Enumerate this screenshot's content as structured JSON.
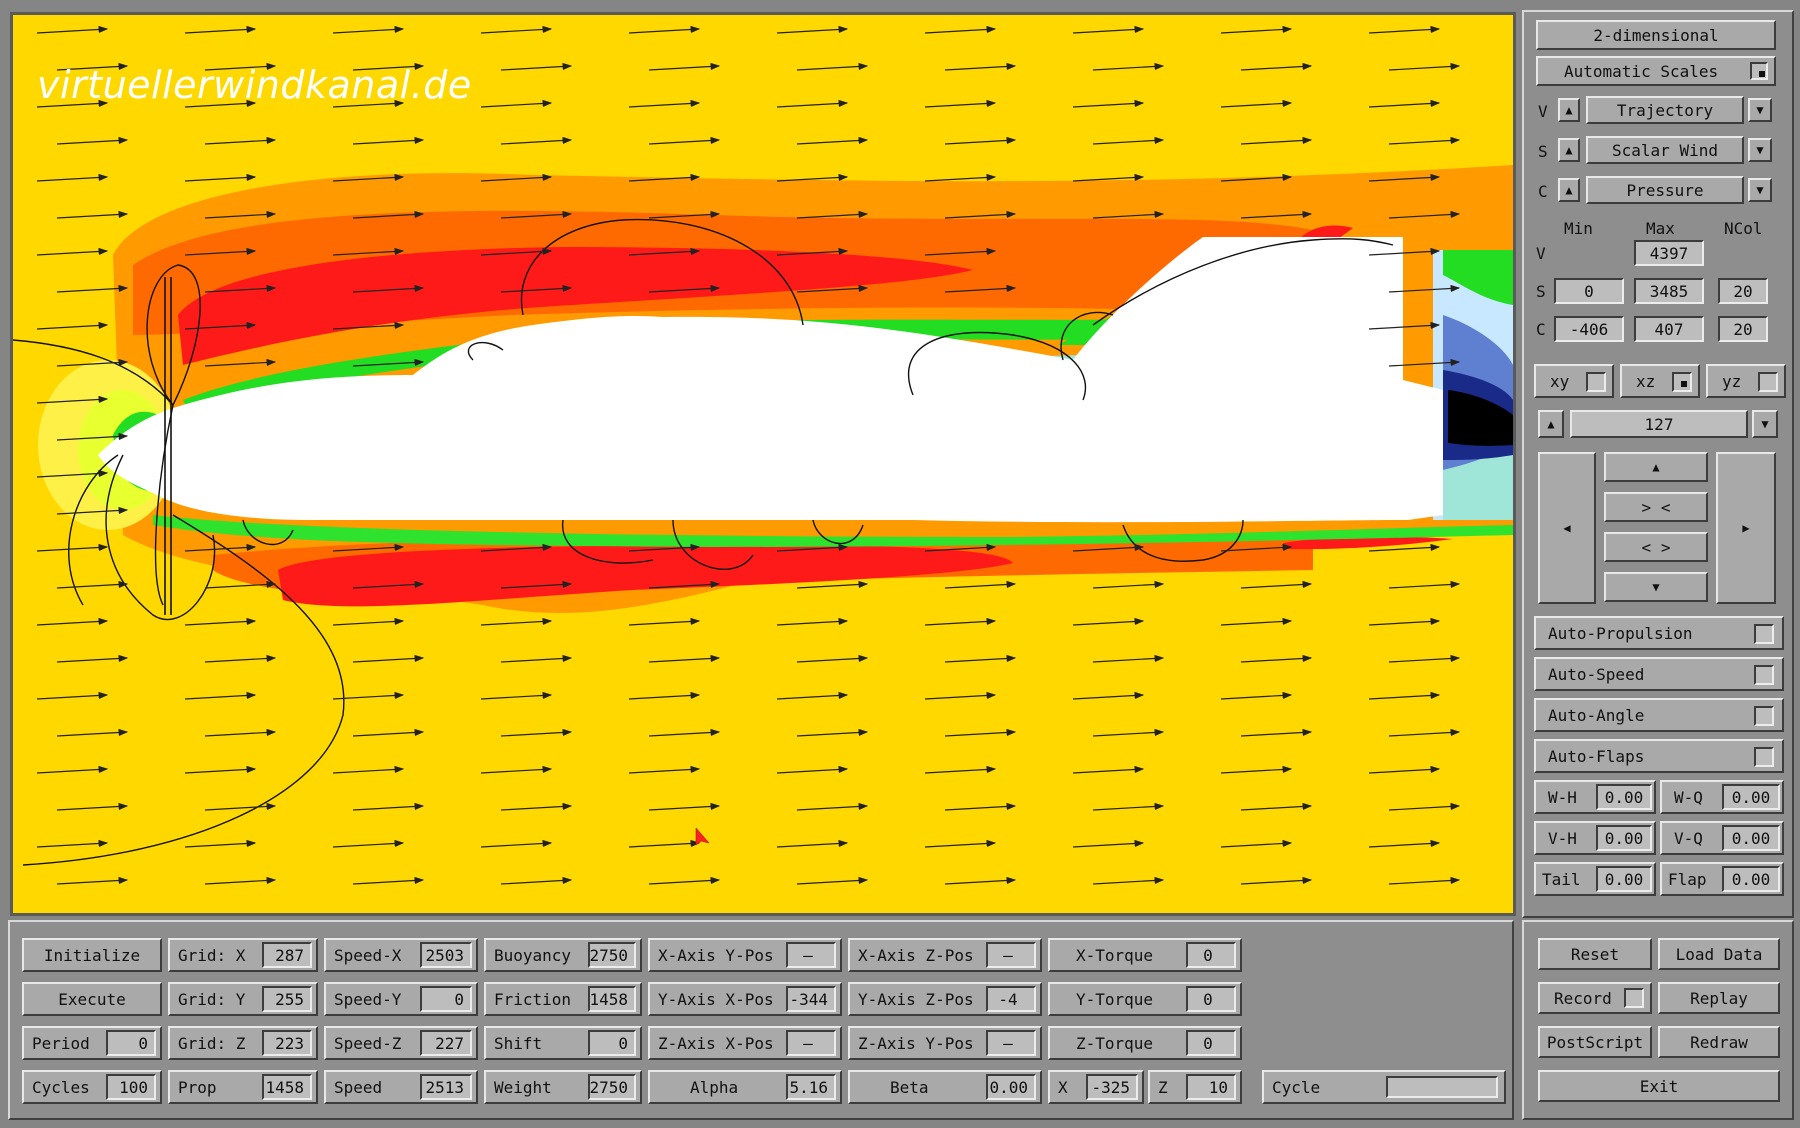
{
  "watermark": "virtuellerwindkanal.de",
  "colors": {
    "ambient": "#ffd800",
    "orange": "#ff9a00",
    "deep_orange": "#ff6a00",
    "red": "#ff1a1a",
    "yellow_green": "#e8ff30",
    "green": "#22dd22",
    "light_green": "#a8ff90",
    "teal": "#9fe6d8",
    "light_blue": "#c8e8ff",
    "blue": "#5f7fd0",
    "navy": "#1a2a88",
    "black": "#000000",
    "body": "#ffffff",
    "panel_gray": "#8e8e8e"
  },
  "right_panel": {
    "mode": "2-dimensional",
    "auto_scales": "Automatic Scales",
    "v_row": {
      "tag": "V",
      "value": "Trajectory"
    },
    "s_row": {
      "tag": "S",
      "value": "Scalar Wind"
    },
    "c_row": {
      "tag": "C",
      "value": "Pressure"
    },
    "headers": {
      "min": "Min",
      "max": "Max",
      "ncol": "NCol"
    },
    "v_scale": {
      "tag": "V",
      "max": "4397"
    },
    "s_scale": {
      "tag": "S",
      "min": "0",
      "max": "3485",
      "ncol": "20"
    },
    "c_scale": {
      "tag": "C",
      "min": "-406",
      "max": "407",
      "ncol": "20"
    },
    "planes": {
      "xy": "xy",
      "xz": "xz",
      "yz": "yz"
    },
    "slice": "127",
    "nav": {
      "up": "▲",
      "zoom_in": "> <",
      "zoom_out": "< >",
      "down": "▼",
      "left": "◀",
      "right": "▶"
    },
    "autos": [
      "Auto-Propulsion",
      "Auto-Speed",
      "Auto-Angle",
      "Auto-Flaps"
    ],
    "params": [
      {
        "l1": "W-H",
        "v1": "0.00",
        "l2": "W-Q",
        "v2": "0.00"
      },
      {
        "l1": "V-H",
        "v1": "0.00",
        "l2": "V-Q",
        "v2": "0.00"
      },
      {
        "l1": "Tail",
        "v1": "0.00",
        "l2": "Flap",
        "v2": "0.00"
      }
    ]
  },
  "bottom": {
    "initialize": "Initialize",
    "execute": "Execute",
    "period": {
      "label": "Period",
      "value": "0"
    },
    "cycles": {
      "label": "Cycles",
      "value": "100"
    },
    "grid_x": {
      "label": "Grid: X",
      "value": "287"
    },
    "grid_y": {
      "label": "Grid: Y",
      "value": "255"
    },
    "grid_z": {
      "label": "Grid: Z",
      "value": "223"
    },
    "prop": {
      "label": "Prop",
      "value": "1458"
    },
    "speed_x": {
      "label": "Speed-X",
      "value": "2503"
    },
    "speed_y": {
      "label": "Speed-Y",
      "value": "0"
    },
    "speed_z": {
      "label": "Speed-Z",
      "value": "227"
    },
    "speed": {
      "label": "Speed",
      "value": "2513"
    },
    "buoyancy": {
      "label": "Buoyancy",
      "value": "2750"
    },
    "friction": {
      "label": "Friction",
      "value": "1458"
    },
    "shift": {
      "label": "Shift",
      "value": "0"
    },
    "weight": {
      "label": "Weight",
      "value": "2750"
    },
    "xaxis_ypos": {
      "label": "X-Axis Y-Pos",
      "value": "—"
    },
    "yaxis_xpos": {
      "label": "Y-Axis X-Pos",
      "value": "-344"
    },
    "zaxis_xpos": {
      "label": "Z-Axis X-Pos",
      "value": "—"
    },
    "alpha": {
      "label": "Alpha",
      "value": "5.16"
    },
    "xaxis_zpos": {
      "label": "X-Axis Z-Pos",
      "value": "—"
    },
    "yaxis_zpos": {
      "label": "Y-Axis Z-Pos",
      "value": "-4"
    },
    "zaxis_ypos": {
      "label": "Z-Axis Y-Pos",
      "value": "—"
    },
    "beta": {
      "label": "Beta",
      "value": "0.00"
    },
    "x_torque": {
      "label": "X-Torque",
      "value": "0"
    },
    "y_torque": {
      "label": "Y-Torque",
      "value": "0"
    },
    "z_torque": {
      "label": "Z-Torque",
      "value": "0"
    },
    "x": {
      "label": "X",
      "value": "-325"
    },
    "z": {
      "label": "Z",
      "value": "10"
    },
    "cycle": "Cycle",
    "cycle_progress": 0.0
  },
  "actions": {
    "reset": "Reset",
    "load_data": "Load Data",
    "record": "Record",
    "replay": "Replay",
    "postscript": "PostScript",
    "redraw": "Redraw",
    "exit": "Exit"
  }
}
